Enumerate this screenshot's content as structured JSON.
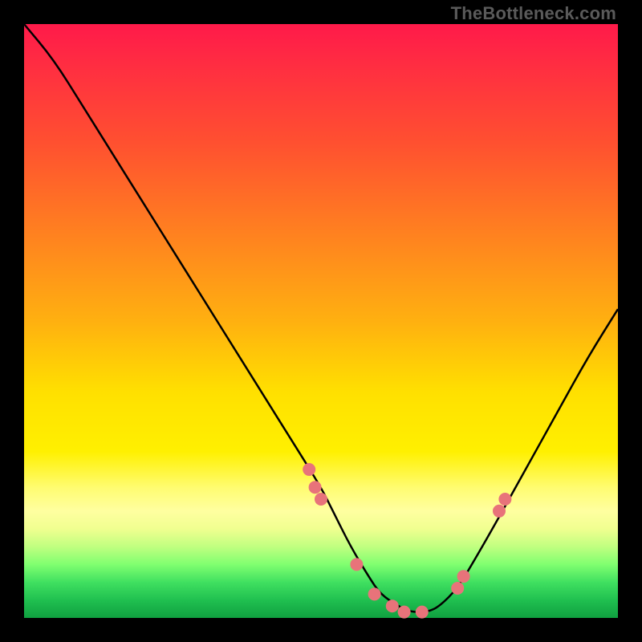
{
  "watermark": "TheBottleneck.com",
  "chart_data": {
    "type": "line",
    "title": "",
    "xlabel": "",
    "ylabel": "",
    "xlim": [
      0,
      100
    ],
    "ylim": [
      0,
      100
    ],
    "grid": false,
    "legend": false,
    "series": [
      {
        "name": "bottleneck-curve",
        "x": [
          0,
          5,
          10,
          15,
          20,
          25,
          30,
          35,
          40,
          45,
          50,
          52,
          55,
          58,
          60,
          63,
          65,
          68,
          70,
          73,
          76,
          80,
          85,
          90,
          95,
          100
        ],
        "y": [
          100,
          94,
          86,
          78,
          70,
          62,
          54,
          46,
          38,
          30,
          22,
          18,
          12,
          7,
          4,
          2,
          1,
          1,
          2,
          5,
          10,
          17,
          26,
          35,
          44,
          52
        ]
      },
      {
        "name": "highlight-points",
        "x": [
          48,
          49,
          50,
          56,
          59,
          62,
          64,
          67,
          73,
          74,
          80,
          81
        ],
        "y": [
          25,
          22,
          20,
          9,
          4,
          2,
          1,
          1,
          5,
          7,
          18,
          20
        ]
      }
    ],
    "background_gradient": {
      "top": "#ff1a4a",
      "mid": "#ffe000",
      "bottom": "#10a040"
    }
  }
}
